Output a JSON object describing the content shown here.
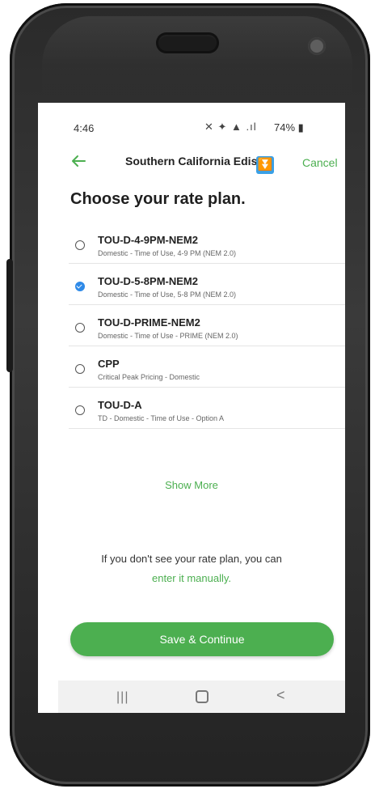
{
  "status_bar": {
    "time": "4:46",
    "icons": "✕ ✦ ▲ .ıl",
    "battery": "74%"
  },
  "header": {
    "title": "Southern California Ediso",
    "cancel_label": "Cancel",
    "overlay_icon_glyph": "⏬"
  },
  "page_title": "Choose your rate plan.",
  "plans": [
    {
      "name": "TOU-D-4-9PM-NEM2",
      "description": "Domestic - Time of Use, 4-9 PM (NEM 2.0)",
      "selected": false
    },
    {
      "name": "TOU-D-5-8PM-NEM2",
      "description": "Domestic - Time of Use, 5-8 PM (NEM 2.0)",
      "selected": true
    },
    {
      "name": "TOU-D-PRIME-NEM2",
      "description": "Domestic - Time of Use - PRIME (NEM 2.0)",
      "selected": false
    },
    {
      "name": "CPP",
      "description": "Critical Peak Pricing - Domestic",
      "selected": false
    },
    {
      "name": "TOU-D-A",
      "description": "TD - Domestic - Time of Use - Option A",
      "selected": false
    }
  ],
  "show_more_label": "Show More",
  "info": {
    "line1": "If you don't see your rate plan, you can",
    "link": "enter it manually."
  },
  "save_label": "Save & Continue",
  "nav": {
    "recent_glyph": "|||",
    "back_glyph": "<"
  },
  "colors": {
    "accent": "#4CAF50",
    "selected_radio": "#2f8ae8"
  }
}
